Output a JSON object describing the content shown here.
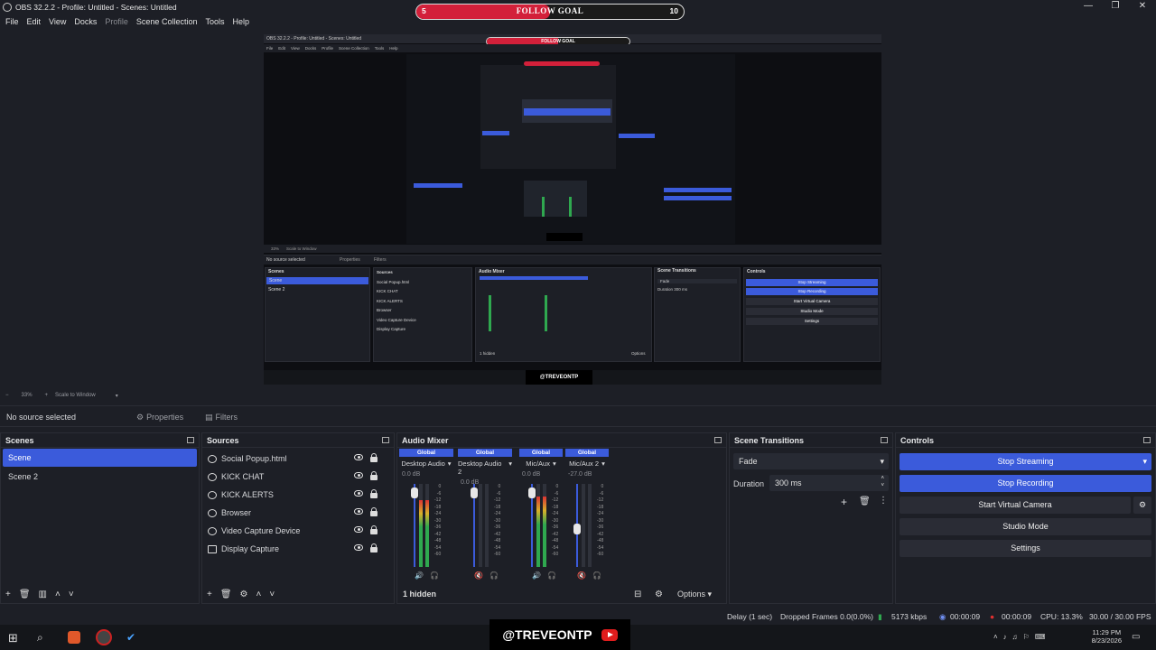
{
  "window": {
    "title": "OBS 32.2.2 - Profile: Untitled - Scenes: Untitled",
    "minimize": "—",
    "maximize": "❐",
    "close": "✕"
  },
  "goal": {
    "low": "5",
    "label": "FOLLOW GOAL",
    "high": "10",
    "progress": 0.5,
    "color": "#d3203a"
  },
  "menu": [
    "File",
    "Edit",
    "View",
    "Docks",
    "Profile",
    "Scene Collection",
    "Tools",
    "Help"
  ],
  "zoom": {
    "percent": "33%",
    "mode": "Scale to Window"
  },
  "properties_bar": {
    "no_source": "No source selected",
    "properties": "Properties",
    "filters": "Filters"
  },
  "scenes": {
    "title": "Scenes",
    "items": [
      "Scene",
      "Scene 2"
    ],
    "selected": 0
  },
  "sources": {
    "title": "Sources",
    "items": [
      {
        "label": "Social Popup.html",
        "icon": "globe-icon"
      },
      {
        "label": "KICK CHAT",
        "icon": "globe-icon"
      },
      {
        "label": "KICK ALERTS",
        "icon": "globe-icon"
      },
      {
        "label": "Browser",
        "icon": "globe-icon"
      },
      {
        "label": "Video Capture Device",
        "icon": "camera-icon"
      },
      {
        "label": "Display Capture",
        "icon": "monitor-icon"
      }
    ]
  },
  "mixer": {
    "title": "Audio Mixer",
    "channels": [
      {
        "badge": "Global",
        "name": "Desktop Audio",
        "db": "0.0 dB",
        "level": 0.8,
        "fader": 0.95,
        "muted": false
      },
      {
        "badge": "Global",
        "name": "Desktop Audio 2",
        "db": "0.0 dB",
        "level": 0.0,
        "fader": 0.95,
        "muted": true
      },
      {
        "badge": "Global",
        "name": "Mic/Aux",
        "db": "0.0 dB",
        "level": 0.85,
        "fader": 0.95,
        "muted": false
      },
      {
        "badge": "Global",
        "name": "Mic/Aux 2",
        "db": "-27.0 dB",
        "level": 0.0,
        "fader": 0.45,
        "muted": true
      }
    ],
    "hidden": "1 hidden",
    "options": "Options",
    "ticks": [
      "0",
      "-6",
      "-12",
      "-18",
      "-24",
      "-30",
      "-36",
      "-42",
      "-48",
      "-54",
      "-60"
    ]
  },
  "transitions": {
    "title": "Scene Transitions",
    "type": "Fade",
    "duration_label": "Duration",
    "duration": "300 ms"
  },
  "controls": {
    "title": "Controls",
    "stop_streaming": "Stop Streaming",
    "stop_recording": "Stop Recording",
    "virtual_camera": "Start Virtual Camera",
    "studio_mode": "Studio Mode",
    "settings": "Settings"
  },
  "status": {
    "delay": "Delay (1 sec)",
    "dropped": "Dropped Frames 0.0(0.0%)",
    "bitrate": "5173 kbps",
    "stream_time": "00:00:09",
    "rec_time": "00:00:09",
    "cpu": "CPU: 13.3%",
    "fps": "30.00 / 30.00 FPS"
  },
  "taskbar": {
    "watermark": "@TREVEONTP",
    "time": "11:29 PM",
    "date": "8/23/2026"
  },
  "preview": {
    "title": "OBS 32.2.2 - Profile: Untitled - Scenes: Untitled",
    "menu": [
      "File",
      "Edit",
      "View",
      "Docks",
      "Profile",
      "Scene Collection",
      "Tools",
      "Help"
    ],
    "goal_label": "FOLLOW GOAL",
    "no_source": "No source selected",
    "properties": "Properties",
    "filters": "Filters",
    "zoom": "33%",
    "zoom_mode": "Scale to Window",
    "scenes_title": "Scenes",
    "scenes": [
      "Scene",
      "Scene 2"
    ],
    "sources_title": "Sources",
    "sources": [
      "Social Popup.html",
      "KICK CHAT",
      "KICK ALERTS",
      "Browser",
      "Video Capture Device",
      "Display Capture"
    ],
    "mixer_title": "Audio Mixer",
    "hidden": "1 hidden",
    "options": "Options",
    "transitions_title": "Scene Transitions",
    "fade": "Fade",
    "duration_label": "Duration",
    "duration": "300 ms",
    "controls_title": "Controls",
    "controls": [
      "Stop Streaming",
      "Stop Recording",
      "Start Virtual Camera",
      "Studio Mode",
      "Settings"
    ],
    "watermark": "@TREVEONTP"
  }
}
